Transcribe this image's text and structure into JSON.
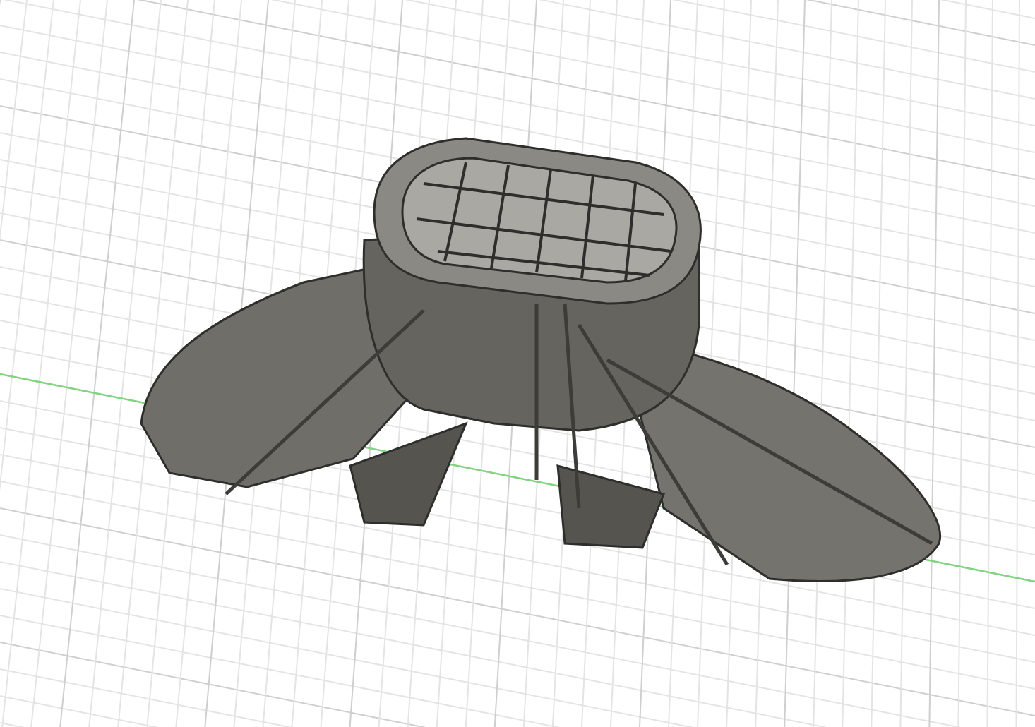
{
  "viewport": {
    "grid": true,
    "axis_line": true
  }
}
